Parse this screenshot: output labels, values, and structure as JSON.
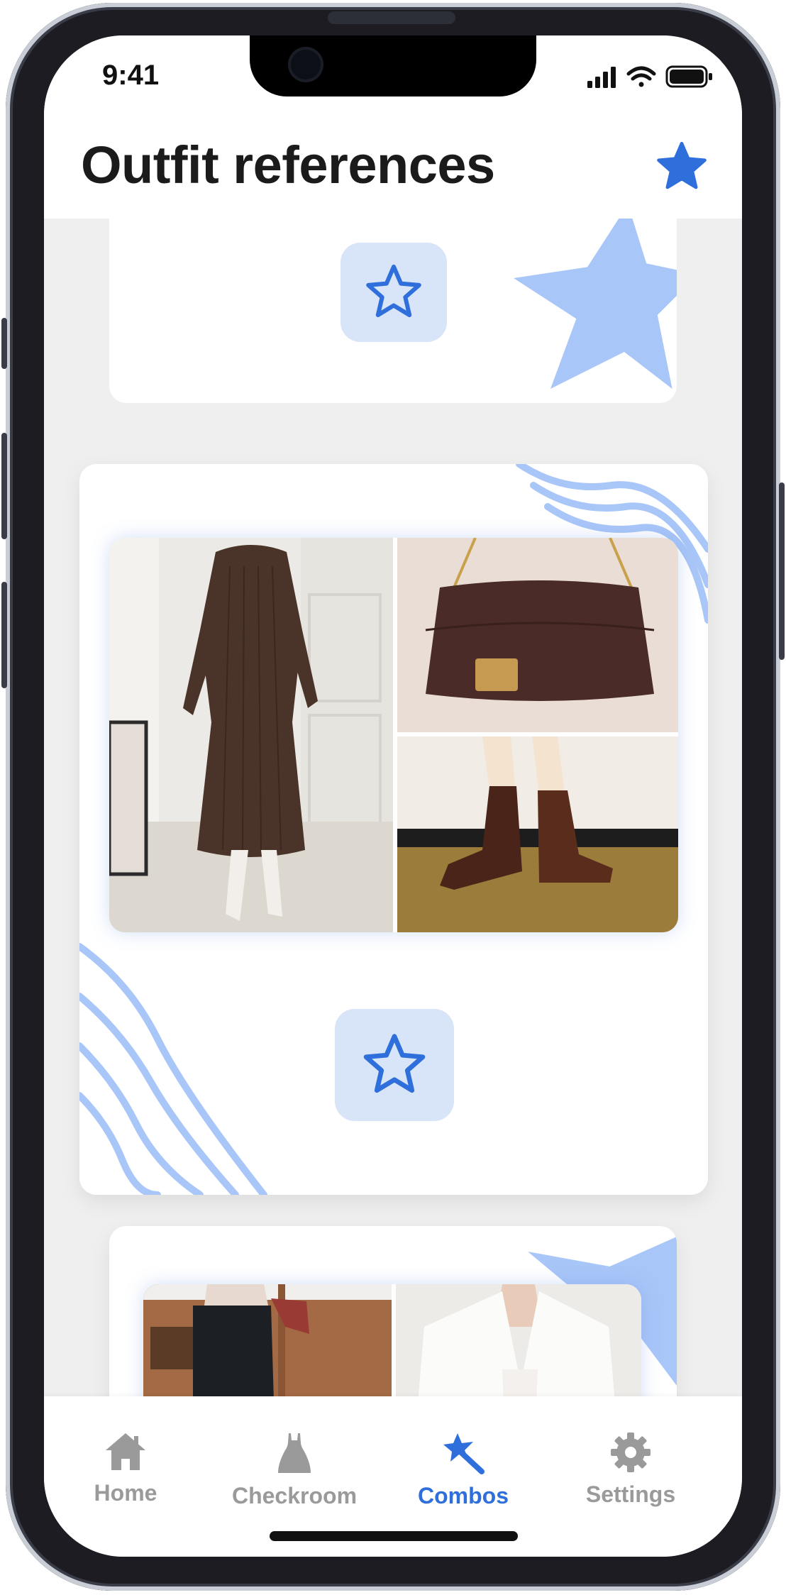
{
  "status_bar": {
    "time": "9:41"
  },
  "header": {
    "title": "Outfit references"
  },
  "cards": [
    {
      "favorite": false
    },
    {
      "favorite": false
    },
    {
      "favorite": false
    }
  ],
  "tab_bar": {
    "active": "Combos",
    "items": [
      {
        "label": "Home",
        "icon": "house-icon"
      },
      {
        "label": "Checkroom",
        "icon": "dress-icon"
      },
      {
        "label": "Combos",
        "icon": "magic-wand-star-icon"
      },
      {
        "label": "Settings",
        "icon": "gear-icon"
      }
    ]
  },
  "colors": {
    "accent": "#2f6fdb",
    "accent_soft": "#d8e4f7",
    "decor_blue": "#a9c6f8",
    "background": "#efefef",
    "inactive": "#9a9a9a"
  }
}
